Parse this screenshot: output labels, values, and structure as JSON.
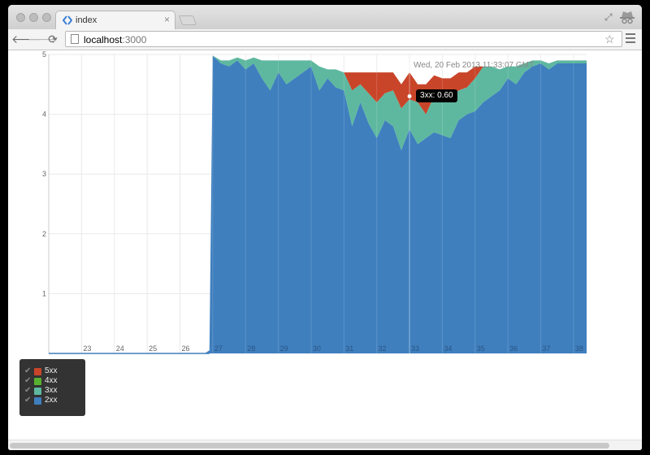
{
  "browser": {
    "tab_title": "index",
    "tab_close": "×",
    "url_host": "localhost",
    "url_port": ":3000",
    "icons": {
      "back": "arrow-left-icon",
      "forward": "arrow-right-icon",
      "reload": "reload-icon",
      "star": "star-icon",
      "menu": "menu-icon",
      "incognito": "incognito-icon",
      "restore": "restore-icon"
    },
    "glyphs": {
      "back": "🡐",
      "forward": "🡒",
      "reload": "⟳",
      "star": "☆",
      "restore": "⤢"
    }
  },
  "chart_data": {
    "type": "area",
    "stacked": true,
    "x": [
      23,
      23.25,
      23.5,
      23.75,
      24,
      24.25,
      24.5,
      24.75,
      25,
      25.25,
      25.5,
      25.75,
      26,
      26.25,
      26.5,
      26.75,
      26.9,
      27,
      27.25,
      27.5,
      27.75,
      28,
      28.25,
      28.5,
      28.75,
      29,
      29.25,
      29.5,
      29.75,
      30,
      30.25,
      30.5,
      30.75,
      31,
      31.25,
      31.5,
      31.75,
      32,
      32.25,
      32.5,
      32.75,
      33,
      33.25,
      33.5,
      33.75,
      34,
      34.25,
      34.5,
      34.75,
      35,
      35.25,
      35.5,
      35.75,
      36,
      36.25,
      36.5,
      36.75,
      37,
      37.25,
      37.5,
      37.75,
      38,
      38.4
    ],
    "series": [
      {
        "name": "5xx",
        "color": "#c9452a",
        "values": [
          0,
          0,
          0,
          0,
          0,
          0,
          0,
          0,
          0,
          0,
          0,
          0,
          0,
          0,
          0,
          0,
          0,
          0,
          0,
          0,
          0,
          0,
          0,
          0,
          0,
          0,
          0,
          0,
          0,
          0,
          0,
          0,
          0,
          0,
          0.3,
          0.2,
          0.35,
          0.5,
          0.35,
          0.3,
          0.4,
          0.45,
          0.3,
          0.5,
          0.35,
          0.4,
          0.3,
          0.3,
          0.25,
          0.2,
          0,
          0,
          0,
          0,
          0,
          0,
          0,
          0,
          0,
          0,
          0,
          0,
          0
        ]
      },
      {
        "name": "4xx",
        "color": "#58b030",
        "values": [
          0,
          0,
          0,
          0,
          0,
          0,
          0,
          0,
          0,
          0,
          0,
          0,
          0,
          0,
          0,
          0,
          0,
          0,
          0,
          0,
          0,
          0,
          0,
          0,
          0,
          0,
          0,
          0,
          0,
          0,
          0,
          0,
          0,
          0,
          0,
          0,
          0,
          0,
          0,
          0,
          0,
          0,
          0,
          0,
          0,
          0,
          0,
          0,
          0,
          0,
          0,
          0,
          0,
          0,
          0,
          0,
          0,
          0,
          0,
          0,
          0,
          0,
          0
        ]
      },
      {
        "name": "3xx",
        "color": "#5eb89f",
        "values": [
          0,
          0,
          0,
          0,
          0,
          0,
          0,
          0,
          0,
          0,
          0,
          0,
          0,
          0,
          0,
          0,
          0,
          0,
          0.05,
          0.1,
          0.05,
          0.15,
          0.1,
          0.3,
          0.5,
          0.2,
          0.4,
          0.3,
          0.2,
          0.1,
          0.4,
          0.15,
          0.3,
          0.3,
          0.6,
          0.3,
          0.5,
          0.6,
          0.45,
          0.6,
          0.7,
          0.5,
          0.7,
          0.4,
          0.6,
          0.55,
          0.7,
          0.5,
          0.45,
          0.55,
          0.6,
          0.5,
          0.35,
          0.2,
          0.3,
          0.15,
          0.1,
          0.05,
          0.1,
          0.05,
          0.05,
          0.05,
          0.05
        ]
      },
      {
        "name": "2xx",
        "color": "#3f7fbe",
        "values": [
          0,
          0,
          0,
          0,
          0,
          0,
          0,
          0,
          0,
          0,
          0,
          0,
          0,
          0,
          0,
          0,
          0.05,
          4.98,
          4.85,
          4.8,
          4.9,
          4.75,
          4.85,
          4.6,
          4.4,
          4.7,
          4.5,
          4.6,
          4.7,
          4.8,
          4.4,
          4.6,
          4.45,
          4.4,
          3.8,
          4.2,
          3.85,
          3.6,
          3.9,
          3.8,
          3.4,
          3.75,
          3.5,
          3.6,
          3.7,
          3.65,
          3.6,
          3.9,
          4.0,
          4.05,
          4.2,
          4.3,
          4.4,
          4.6,
          4.5,
          4.7,
          4.8,
          4.85,
          4.75,
          4.85,
          4.85,
          4.85,
          4.85
        ]
      }
    ],
    "x_ticks": [
      23,
      24,
      25,
      26,
      27,
      28,
      29,
      30,
      31,
      32,
      33,
      34,
      35,
      36,
      37,
      38
    ],
    "y_ticks": [
      1,
      2,
      3,
      4,
      5
    ],
    "xlim": [
      22,
      38.4
    ],
    "ylim": [
      0,
      5
    ],
    "grid": true,
    "hover_time": "Wed, 20 Feb 2013 11:33:07 GMT",
    "tooltip": {
      "text": "3xx: 0.60",
      "x": 33,
      "y": 4.3
    }
  },
  "legend": [
    {
      "label": "5xx",
      "color": "#c9452a",
      "check": "✔"
    },
    {
      "label": "4xx",
      "color": "#58b030",
      "check": "✔"
    },
    {
      "label": "3xx",
      "color": "#5eb89f",
      "check": "✔"
    },
    {
      "label": "2xx",
      "color": "#3f7fbe",
      "check": "✔"
    }
  ]
}
